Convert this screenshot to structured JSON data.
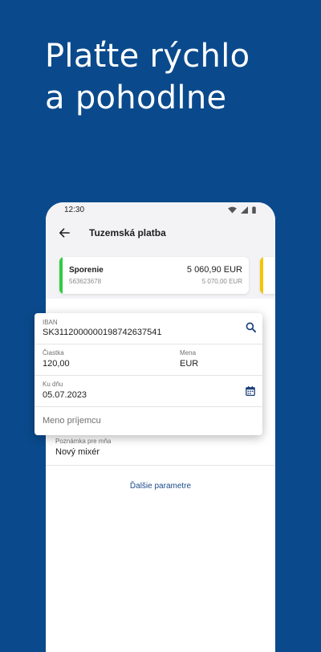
{
  "headline": {
    "line1": "Plaťte rýchlo",
    "line2": "a pohodlne"
  },
  "status_bar": {
    "time": "12:30"
  },
  "app_bar": {
    "title": "Tuzemská platba"
  },
  "account_card": {
    "name": "Sporenie",
    "number": "563623678",
    "balance": "5 060,90 EUR",
    "available": "5 070,00 EUR"
  },
  "form": {
    "iban_label": "IBAN",
    "iban_value": "SK3112000000198742637541",
    "amount_label": "Čiastka",
    "amount_value": "120,00",
    "currency_label": "Mena",
    "currency_value": "EUR",
    "date_label": "Ku dňu",
    "date_value": "05.07.2023",
    "recipient_placeholder": "Meno príjemcu"
  },
  "note": {
    "label": "Poznámka pre mňa",
    "value": "Nový mixér"
  },
  "more_params_label": "Ďalšie parametre",
  "colors": {
    "background": "#0a4a8c",
    "accent_green": "#2ecc40",
    "accent_yellow": "#f5c400",
    "link": "#1b4a8a"
  },
  "icons": [
    "wifi-icon",
    "signal-icon",
    "battery-icon",
    "back-arrow-icon",
    "search-icon",
    "calendar-icon"
  ]
}
